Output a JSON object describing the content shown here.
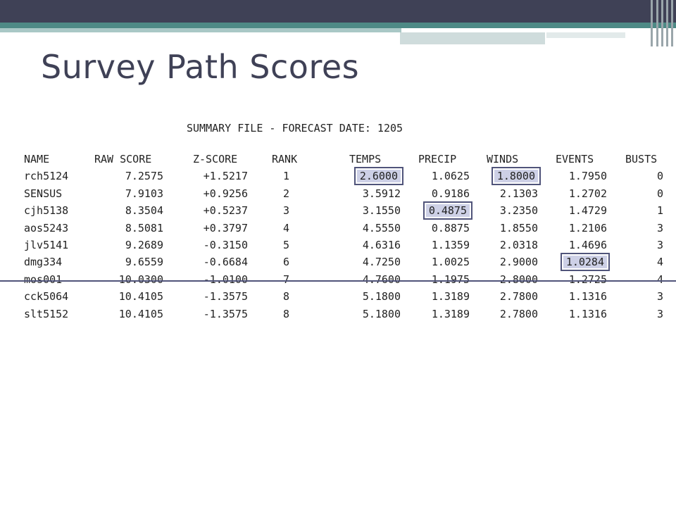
{
  "slide": {
    "title": "Survey Path Scores"
  },
  "summary": {
    "heading": "SUMMARY FILE - FORECAST DATE: 1205",
    "columns": [
      "NAME",
      "RAW SCORE",
      "Z-SCORE",
      "RANK",
      "TEMPS",
      "PRECIP",
      "WINDS",
      "EVENTS",
      "BUSTS"
    ],
    "rows": [
      [
        "rch5124",
        "7.2575",
        "+1.5217",
        "1",
        "2.6000",
        "1.0625",
        "1.8000",
        "1.7950",
        "0"
      ],
      [
        "SENSUS",
        "7.9103",
        "+0.9256",
        "2",
        "3.5912",
        "0.9186",
        "2.1303",
        "1.2702",
        "0"
      ],
      [
        "cjh5138",
        "8.3504",
        "+0.5237",
        "3",
        "3.1550",
        "0.4875",
        "3.2350",
        "1.4729",
        "1"
      ],
      [
        "aos5243",
        "8.5081",
        "+0.3797",
        "4",
        "4.5550",
        "0.8875",
        "1.8550",
        "1.2106",
        "3"
      ],
      [
        "jlv5141",
        "9.2689",
        "-0.3150",
        "5",
        "4.6316",
        "1.1359",
        "2.0318",
        "1.4696",
        "3"
      ],
      [
        "dmg334",
        "9.6559",
        "-0.6684",
        "6",
        "4.7250",
        "1.0025",
        "2.9000",
        "1.0284",
        "4"
      ],
      [
        "mos001",
        "10.0300",
        "-1.0100",
        "7",
        "4.7600",
        "1.1975",
        "2.8000",
        "1.2725",
        "4"
      ],
      [
        "cck5064",
        "10.4105",
        "-1.3575",
        "8",
        "5.1800",
        "1.3189",
        "2.7800",
        "1.1316",
        "3"
      ],
      [
        "slt5152",
        "10.4105",
        "-1.3575",
        "8",
        "5.1800",
        "1.3189",
        "2.7800",
        "1.1316",
        "3"
      ]
    ],
    "highlighted_cells": [
      {
        "row": 0,
        "column": "TEMPS"
      },
      {
        "row": 0,
        "column": "WINDS"
      },
      {
        "row": 2,
        "column": "PRECIP"
      },
      {
        "row": 5,
        "column": "EVENTS"
      }
    ]
  },
  "colors": {
    "title": "#3f4156",
    "header_band": "#3f4156",
    "accent_teal": "#4e8a86",
    "highlight_fill": "#cdd0e6",
    "highlight_border": "#50547a"
  }
}
